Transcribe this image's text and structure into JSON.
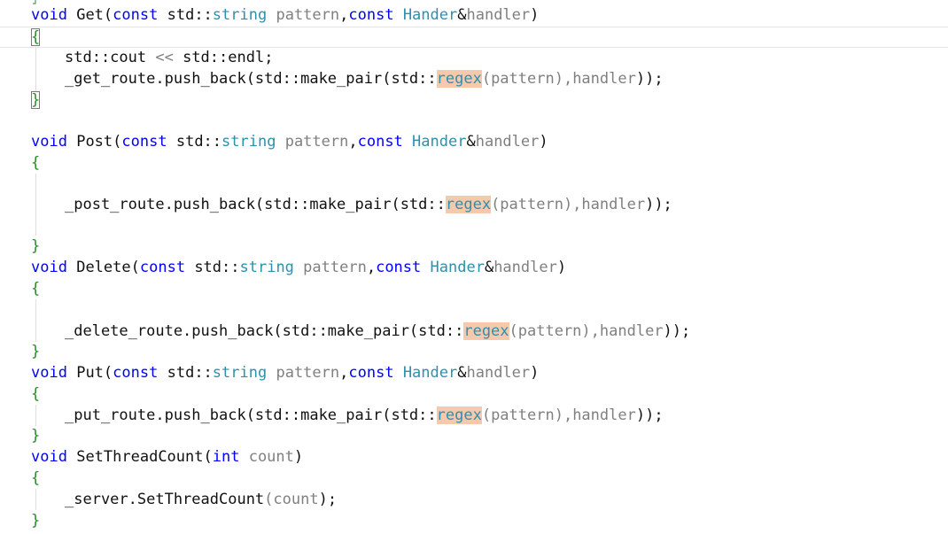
{
  "colors": {
    "keyword": "#0000ff",
    "type": "#2b91af",
    "param": "#808080",
    "brace": "#2a8a2a",
    "highlight": "#f6c9ad"
  },
  "code": {
    "get": {
      "void": "void",
      "name": "Get",
      "lp": "(",
      "const1": "const",
      "std1": "std::",
      "string": "string",
      "p1": "pattern",
      "comma": ",",
      "const2": "const",
      "hander": "Hander",
      "amp": "&",
      "handler": "handler",
      "rp": ")",
      "open": "{",
      "cout": "std::cout ",
      "shl": "<<",
      "endl": " std::endl;",
      "call_prefix": "_get_route.push_back(std::make_pair(std::",
      "regex": "regex",
      "call_mid": "(pattern),",
      "call_handler": "handler",
      "call_end": "));",
      "close": "}"
    },
    "post": {
      "void": "void",
      "name": "Post",
      "lp": "(",
      "const1": "const",
      "std1": "std::",
      "string": "string",
      "p1": "pattern",
      "comma": ",",
      "const2": "const",
      "hander": "Hander",
      "amp": "&",
      "handler": "handler",
      "rp": ")",
      "open": "{",
      "call_prefix": "_post_route.push_back(std::make_pair(std::",
      "regex": "regex",
      "call_mid": "(pattern),",
      "call_handler": "handler",
      "call_end": "));",
      "close": "}"
    },
    "del": {
      "void": "void",
      "name": "Delete",
      "lp": "(",
      "const1": "const",
      "std1": "std::",
      "string": "string",
      "p1": "pattern",
      "comma": ",",
      "const2": "const",
      "hander": "Hander",
      "amp": "&",
      "handler": "handler",
      "rp": ")",
      "open": "{",
      "call_prefix": "_delete_route.push_back(std::make_pair(std::",
      "regex": "regex",
      "call_mid": "(pattern),",
      "call_handler": "handler",
      "call_end": "));",
      "close": "}"
    },
    "put": {
      "void": "void",
      "name": "Put",
      "lp": "(",
      "const1": "const",
      "std1": "std::",
      "string": "string",
      "p1": "pattern",
      "comma": ",",
      "const2": "const",
      "hander": "Hander",
      "amp": "&",
      "handler": "handler",
      "rp": ")",
      "open": "{",
      "call_prefix": "_put_route.push_back(std::make_pair(std::",
      "regex": "regex",
      "call_mid": "(pattern),",
      "call_handler": "handler",
      "call_end": "));",
      "close": "}"
    },
    "stc": {
      "void": "void",
      "name": "SetThreadCount",
      "lp": "(",
      "int": "int",
      "param": " count",
      "rp": ")",
      "open": "{",
      "call_prefix": "_server.SetThreadCount",
      "call_lp": "(",
      "call_arg": "count",
      "call_end": ");",
      "close": "}"
    }
  }
}
